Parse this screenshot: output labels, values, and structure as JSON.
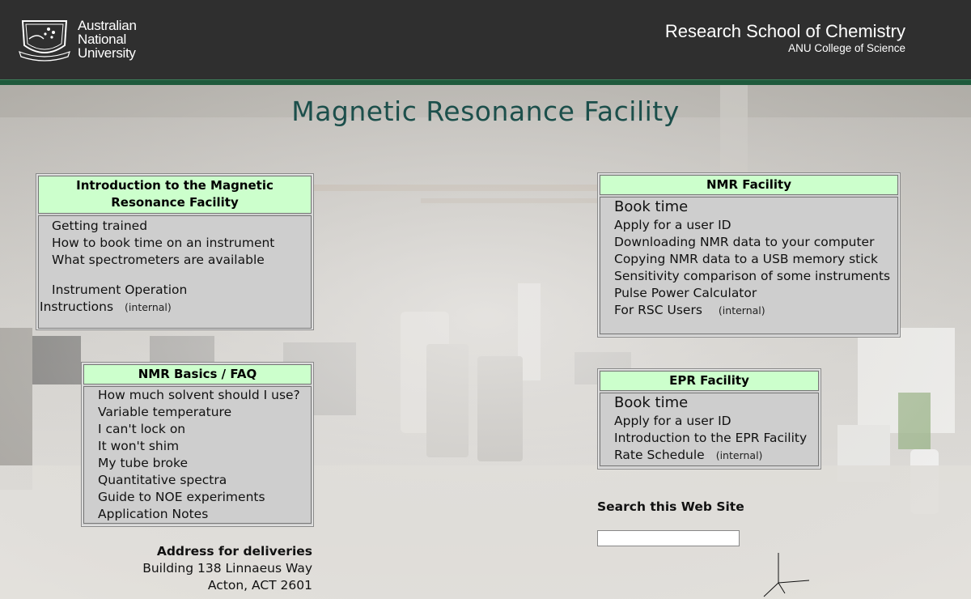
{
  "header": {
    "logo_lines": [
      "Australian",
      "National",
      "University"
    ],
    "school_title": "Research School of Chemistry",
    "school_subtitle": "ANU College of Science"
  },
  "page": {
    "title": "Magnetic Resonance Facility"
  },
  "intro_box": {
    "heading_line1": "Introduction to the Magnetic",
    "heading_line2": "Resonance Facility",
    "items": [
      "Getting trained",
      "How to book time on an instrument",
      "What spectrometers are available"
    ],
    "operation_line1": "Instrument Operation",
    "operation_line2": "Instructions",
    "internal": "(internal)"
  },
  "basics_box": {
    "heading": "NMR Basics / FAQ",
    "items": [
      "How much solvent should I use?",
      "Variable temperature",
      "I can't lock on",
      "It won't shim",
      "My tube broke",
      "Quantitative spectra",
      "Guide to NOE experiments",
      "Application Notes"
    ]
  },
  "nmr_box": {
    "heading": "NMR Facility",
    "book_time": "Book time",
    "items": [
      "Apply for a user ID",
      "Downloading NMR data to your computer",
      "Copying NMR data to a USB memory stick",
      "Sensitivity comparison of some instruments",
      "Pulse Power Calculator"
    ],
    "rsc_users": "For RSC Users",
    "internal": "(internal)"
  },
  "epr_box": {
    "heading": "EPR Facility",
    "book_time": "Book time",
    "items": [
      "Apply for a user ID",
      "Introduction to the EPR Facility"
    ],
    "rate_schedule": "Rate Schedule",
    "internal": "(internal)"
  },
  "search": {
    "label": "Search this Web Site",
    "value": ""
  },
  "address": {
    "heading": "Address for deliveries",
    "line1": "Building 138 Linnaeus Way",
    "line2": "Acton, ACT 2601"
  },
  "colors": {
    "header_bg": "#2f2f2f",
    "accent_green": "#1f5a3c",
    "box_heading_bg": "#ccffcc",
    "title_color": "#1c4f4b"
  }
}
